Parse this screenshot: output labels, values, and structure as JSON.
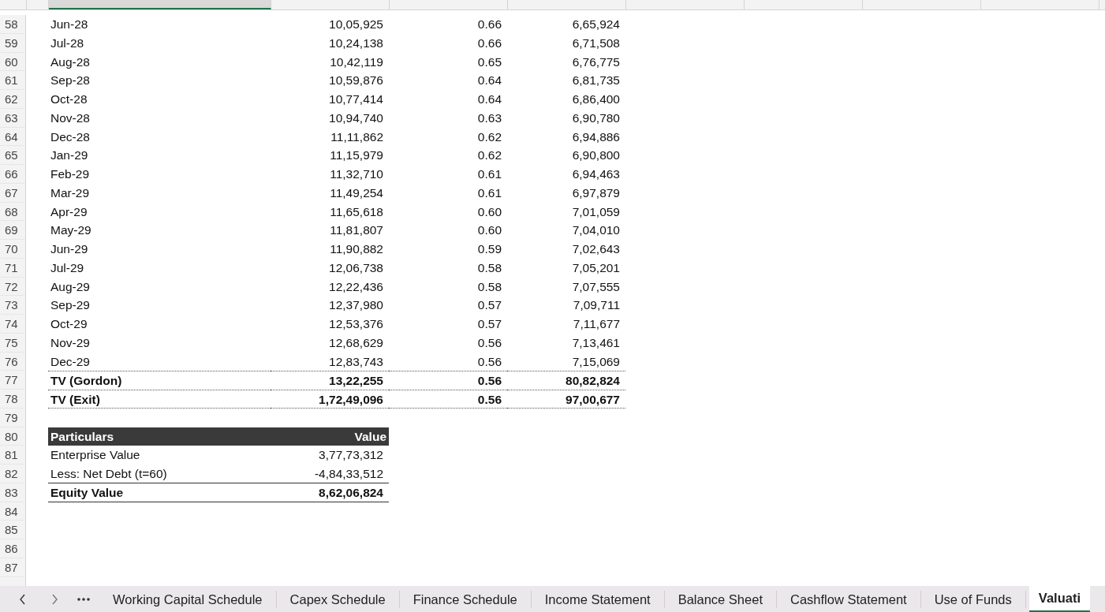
{
  "columns": [
    {
      "selected": false
    },
    {
      "selected": true
    },
    {
      "selected": false
    },
    {
      "selected": false
    },
    {
      "selected": false
    },
    {
      "selected": false
    },
    {
      "selected": false
    },
    {
      "selected": false
    },
    {
      "selected": false
    }
  ],
  "rows": [
    {
      "n": "58",
      "kind": "month",
      "label": "Jun-28",
      "c": "10,05,925",
      "d": "0.66",
      "e": "6,65,924"
    },
    {
      "n": "59",
      "kind": "month",
      "label": "Jul-28",
      "c": "10,24,138",
      "d": "0.66",
      "e": "6,71,508"
    },
    {
      "n": "60",
      "kind": "month",
      "label": "Aug-28",
      "c": "10,42,119",
      "d": "0.65",
      "e": "6,76,775"
    },
    {
      "n": "61",
      "kind": "month",
      "label": "Sep-28",
      "c": "10,59,876",
      "d": "0.64",
      "e": "6,81,735"
    },
    {
      "n": "62",
      "kind": "month",
      "label": "Oct-28",
      "c": "10,77,414",
      "d": "0.64",
      "e": "6,86,400"
    },
    {
      "n": "63",
      "kind": "month",
      "label": "Nov-28",
      "c": "10,94,740",
      "d": "0.63",
      "e": "6,90,780"
    },
    {
      "n": "64",
      "kind": "month",
      "label": "Dec-28",
      "c": "11,11,862",
      "d": "0.62",
      "e": "6,94,886"
    },
    {
      "n": "65",
      "kind": "month",
      "label": "Jan-29",
      "c": "11,15,979",
      "d": "0.62",
      "e": "6,90,800"
    },
    {
      "n": "66",
      "kind": "month",
      "label": "Feb-29",
      "c": "11,32,710",
      "d": "0.61",
      "e": "6,94,463"
    },
    {
      "n": "67",
      "kind": "month",
      "label": "Mar-29",
      "c": "11,49,254",
      "d": "0.61",
      "e": "6,97,879"
    },
    {
      "n": "68",
      "kind": "month",
      "label": "Apr-29",
      "c": "11,65,618",
      "d": "0.60",
      "e": "7,01,059"
    },
    {
      "n": "69",
      "kind": "month",
      "label": "May-29",
      "c": "11,81,807",
      "d": "0.60",
      "e": "7,04,010"
    },
    {
      "n": "70",
      "kind": "month",
      "label": "Jun-29",
      "c": "11,90,882",
      "d": "0.59",
      "e": "7,02,643"
    },
    {
      "n": "71",
      "kind": "month",
      "label": "Jul-29",
      "c": "12,06,738",
      "d": "0.58",
      "e": "7,05,201"
    },
    {
      "n": "72",
      "kind": "month",
      "label": "Aug-29",
      "c": "12,22,436",
      "d": "0.58",
      "e": "7,07,555"
    },
    {
      "n": "73",
      "kind": "month",
      "label": "Sep-29",
      "c": "12,37,980",
      "d": "0.57",
      "e": "7,09,711"
    },
    {
      "n": "74",
      "kind": "month",
      "label": "Oct-29",
      "c": "12,53,376",
      "d": "0.57",
      "e": "7,11,677"
    },
    {
      "n": "75",
      "kind": "month",
      "label": "Nov-29",
      "c": "12,68,629",
      "d": "0.56",
      "e": "7,13,461"
    },
    {
      "n": "76",
      "kind": "month",
      "label": "Dec-29",
      "c": "12,83,743",
      "d": "0.56",
      "e": "7,15,069"
    },
    {
      "n": "77",
      "kind": "total",
      "label": "TV (Gordon)",
      "c": "13,22,255",
      "d": "0.56",
      "e": "80,82,824"
    },
    {
      "n": "78",
      "kind": "total",
      "label": "TV (Exit)",
      "c": "1,72,49,096",
      "d": "0.56",
      "e": "97,00,677"
    },
    {
      "n": "79",
      "kind": "blank"
    },
    {
      "n": "80",
      "kind": "summary_header",
      "label": "Particulars",
      "c": "Value"
    },
    {
      "n": "81",
      "kind": "summary_item",
      "label": "Enterprise Value",
      "c": "3,77,73,312"
    },
    {
      "n": "82",
      "kind": "summary_item_last",
      "label": "Less: Net Debt (t=60)",
      "c": "-4,84,33,512"
    },
    {
      "n": "83",
      "kind": "summary_total",
      "label": "Equity Value",
      "c": "8,62,06,824"
    },
    {
      "n": "84",
      "kind": "blank"
    },
    {
      "n": "85",
      "kind": "blank"
    },
    {
      "n": "86",
      "kind": "blank"
    },
    {
      "n": "87",
      "kind": "blank"
    }
  ],
  "sheet_tabs": [
    {
      "label": "Working Capital Schedule",
      "selected": false
    },
    {
      "label": "Capex Schedule",
      "selected": false
    },
    {
      "label": "Finance Schedule",
      "selected": false
    },
    {
      "label": "Income Statement",
      "selected": false
    },
    {
      "label": "Balance Sheet",
      "selected": false
    },
    {
      "label": "Cashflow Statement",
      "selected": false
    },
    {
      "label": "Use of Funds",
      "selected": false
    },
    {
      "label": "Valuati",
      "selected": true
    }
  ]
}
